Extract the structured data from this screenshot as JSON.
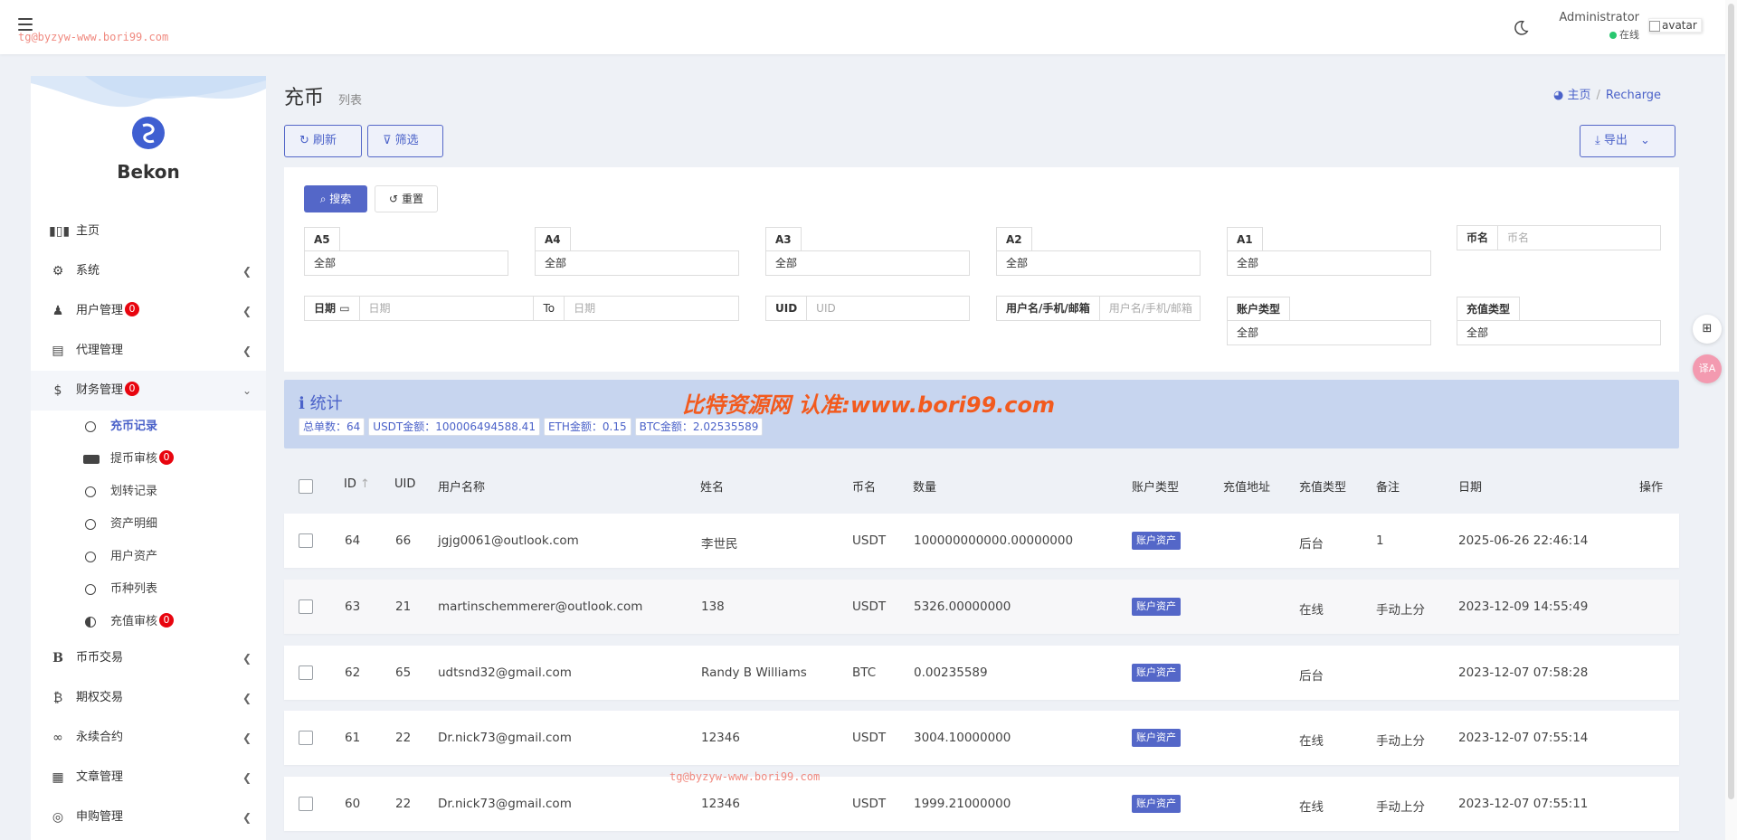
{
  "header": {
    "watermark": "tg@byzyw-www.bori99.com",
    "user_name": "Administrator",
    "user_status": "在线",
    "avatar_alt": "avatar"
  },
  "sidebar": {
    "brand": "Bekon",
    "items": [
      {
        "label": "主页",
        "icon": "bar-chart-icon"
      },
      {
        "label": "系统",
        "icon": "gear-icon"
      },
      {
        "label": "用户管理",
        "icon": "users-icon",
        "badge": "0"
      },
      {
        "label": "代理管理",
        "icon": "id-card-icon"
      },
      {
        "label": "财务管理",
        "icon": "dollar-icon",
        "badge": "0"
      },
      {
        "label": "币币交易",
        "icon": "bitcoin-b-icon"
      },
      {
        "label": "期权交易",
        "icon": "bitcoin-icon"
      },
      {
        "label": "永续合约",
        "icon": "link-icon"
      },
      {
        "label": "文章管理",
        "icon": "newspaper-icon"
      },
      {
        "label": "申购管理",
        "icon": "lifebuoy-icon"
      }
    ],
    "finance_sub": [
      {
        "label": "充币记录"
      },
      {
        "label": "提币审核",
        "badge": "0"
      },
      {
        "label": "划转记录"
      },
      {
        "label": "资产明细"
      },
      {
        "label": "用户资产"
      },
      {
        "label": "币种列表"
      },
      {
        "label": "充值审核",
        "badge": "0"
      }
    ]
  },
  "page": {
    "title": "充币",
    "subtitle": "列表",
    "breadcrumb_home": "主页",
    "breadcrumb_sep": "/",
    "breadcrumb_current": "Recharge"
  },
  "toolbar": {
    "refresh": "刷新",
    "filter": "筛选",
    "export": "导出"
  },
  "filters": {
    "search": "搜索",
    "reset": "重置",
    "a5_label": "A5",
    "a5_value": "全部",
    "a4_label": "A4",
    "a4_value": "全部",
    "a3_label": "A3",
    "a3_value": "全部",
    "a2_label": "A2",
    "a2_value": "全部",
    "a1_label": "A1",
    "a1_value": "全部",
    "coin_label": "币名",
    "coin_placeholder": "币名",
    "date_label": "日期",
    "date_from_placeholder": "日期",
    "date_to_label": "To",
    "date_to_placeholder": "日期",
    "uid_label": "UID",
    "uid_placeholder": "UID",
    "user_label": "用户名/手机/邮箱",
    "user_placeholder": "用户名/手机/邮箱",
    "account_type_label": "账户类型",
    "account_type_value": "全部",
    "recharge_type_label": "充值类型",
    "recharge_type_value": "全部"
  },
  "stats": {
    "title": "统计",
    "watermark": "比特资源网 认准:www.bori99.com",
    "items": [
      "总单数：64",
      "USDT金额：100006494588.41",
      "ETH金额：0.15",
      "BTC金额：2.02535589"
    ]
  },
  "table": {
    "columns": {
      "id": "ID",
      "uid": "UID",
      "username": "用户名称",
      "name": "姓名",
      "coin": "币名",
      "amount": "数量",
      "account_type": "账户类型",
      "address": "充值地址",
      "recharge_type": "充值类型",
      "remark": "备注",
      "date": "日期",
      "actions": "操作"
    },
    "rows": [
      {
        "id": "64",
        "uid": "66",
        "username": "jgjg0061@outlook.com",
        "name": "李世民",
        "coin": "USDT",
        "amount": "100000000000.00000000",
        "account_type": "账户资产",
        "address": "",
        "recharge_type": "后台",
        "remark": "1",
        "date": "2025-06-26 22:46:14"
      },
      {
        "id": "63",
        "uid": "21",
        "username": "martinschemmerer@outlook.com",
        "name": "138",
        "coin": "USDT",
        "amount": "5326.00000000",
        "account_type": "账户资产",
        "address": "",
        "recharge_type": "在线",
        "remark": "手动上分",
        "date": "2023-12-09 14:55:49"
      },
      {
        "id": "62",
        "uid": "65",
        "username": "udtsnd32@gmail.com",
        "name": "Randy B Williams",
        "coin": "BTC",
        "amount": "0.00235589",
        "account_type": "账户资产",
        "address": "",
        "recharge_type": "后台",
        "remark": "",
        "date": "2023-12-07 07:58:28"
      },
      {
        "id": "61",
        "uid": "22",
        "username": "Dr.nick73@gmail.com",
        "name": "12346",
        "coin": "USDT",
        "amount": "3004.10000000",
        "account_type": "账户资产",
        "address": "",
        "recharge_type": "在线",
        "remark": "手动上分",
        "date": "2023-12-07 07:55:14"
      },
      {
        "id": "60",
        "uid": "22",
        "username": "Dr.nick73@gmail.com",
        "name": "12346",
        "coin": "USDT",
        "amount": "1999.21000000",
        "account_type": "账户资产",
        "address": "",
        "recharge_type": "在线",
        "remark": "手动上分",
        "date": "2023-12-07 07:55:11"
      }
    ]
  },
  "watermark_mid": "tg@byzyw-www.bori99.com",
  "float_buttons": {
    "grid": "grid-plus-icon",
    "translate": "translate-icon",
    "translate_label": "译A"
  },
  "colors": {
    "accent": "#5467c8",
    "badge": "#e8050f",
    "stats_bg": "#c7d5ef",
    "online": "#28c76f"
  }
}
